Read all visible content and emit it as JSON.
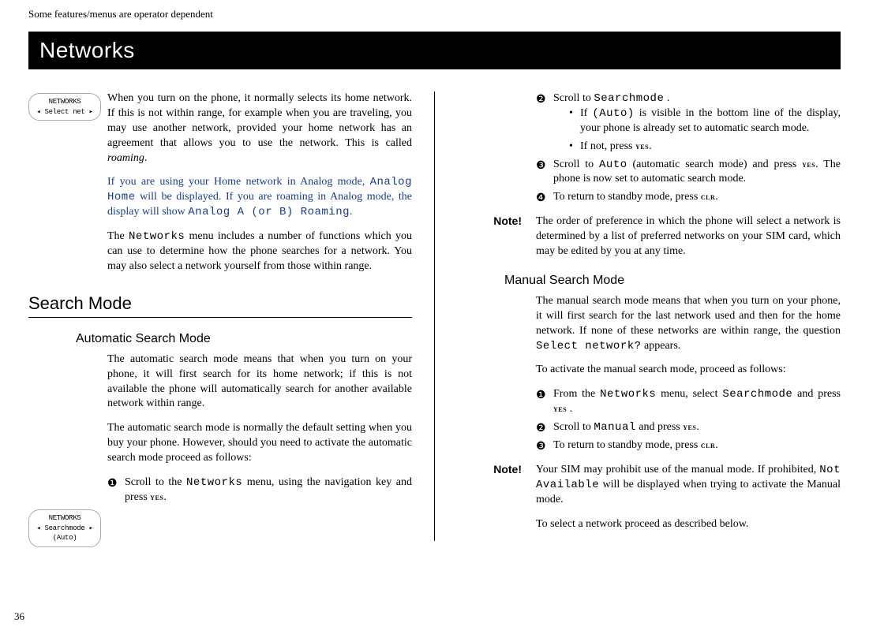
{
  "header": {
    "runningText": "Some features/menus are operator dependent"
  },
  "chapter": {
    "title": "Networks"
  },
  "phoneDisplays": {
    "d1": {
      "line1": "NETWORKS",
      "line2": "Select net"
    },
    "d2": {
      "line1": "NETWORKS",
      "line2": "Searchmode",
      "line3": "(Auto)"
    }
  },
  "leftColumn": {
    "intro1": "When you turn on the phone, it normally selects its home network. If this is not within range, for example when you are traveling, you may use another network, provided your home network has an agreement that allows you to use the network. This is called ",
    "roamingWord": "roaming",
    "intro1End": ".",
    "analogPrefix": "If you are using your Home network in Analog mode, ",
    "analogHome": "Ana­log Home",
    "analogMiddle": " will be displayed. If you are roaming in Analog mode, the display will show  ",
    "analogRoaming": "Analog A (or B) Roaming",
    "analogEnd": ".",
    "intro2a": "The ",
    "networksWord": "Networks",
    "intro2b": " menu includes a number of functions which you can use to determine how the phone searches for a network. You may also select a network yourself from those within range.",
    "sectionHeading": "Search Mode",
    "autoHeading": "Automatic Search Mode",
    "autoPara1": "The automatic search mode means that when you turn on your phone, it will first search for its home network; if this is not available the phone will automatically search for another available network within range.",
    "autoPara2": "The automatic search mode is normally the default setting when you buy your phone. However, should you need to ac­tivate the automatic search mode proceed as follows:",
    "step1a": "Scroll to the ",
    "step1b": " menu, using the navigation key and press ",
    "yesKey": "yes",
    "period": "."
  },
  "rightColumn": {
    "step2a": "Scroll to ",
    "searchmodeWord": "Searchmode",
    "step2b": " .",
    "bullet1a": "If ",
    "autoParen": "(Auto)",
    "bullet1b": " is visible in the bottom line of the display, your phone is already set to automatic search mode.",
    "bullet2a": "If not, press ",
    "step3a": "Scroll to ",
    "autoWord": "Auto",
    "step3b": " (automatic search mode) and press ",
    "step3c": " The phone is now set to automatic search mode.",
    "step4a": "To return to standby mode, press ",
    "clrKey": "clr",
    "noteLabel": "Note!",
    "note1": "The order of preference in which the phone will select a net­work is determined by a list of preferred networks on your SIM card, which may be edited by you at any time.",
    "manualHeading": "Manual Search Mode",
    "manualPara1a": "The manual search mode means that when you turn on your phone, it will first search for the last network used and then for the home  network. If none of these networks are within range, the question ",
    "selectNetworkQ": "Select network?",
    "manualPara1b": " appears.",
    "manualPara2": "To activate the manual search mode, proceed as follows:",
    "mstep1a": "From the ",
    "mstep1b": " menu, select ",
    "mstep1c": " and press ",
    "mstep1d": " .",
    "mstep2a": "Scroll to ",
    "manualWord": "Manual",
    "mstep2b": " and press ",
    "mstep3a": "To return to standby mode, press ",
    "note2a": "Your SIM may prohibit use of the manual mode. If prohib­ited, ",
    "notAvailable": "Not Available",
    "note2b": " will be displayed when trying to activate the Manual mode.",
    "finalPara": "To select a network proceed as described below."
  },
  "pageNumber": "36",
  "stepIcons": {
    "s1": "❶",
    "s2": "❷",
    "s3": "❸",
    "s4": "❹"
  }
}
